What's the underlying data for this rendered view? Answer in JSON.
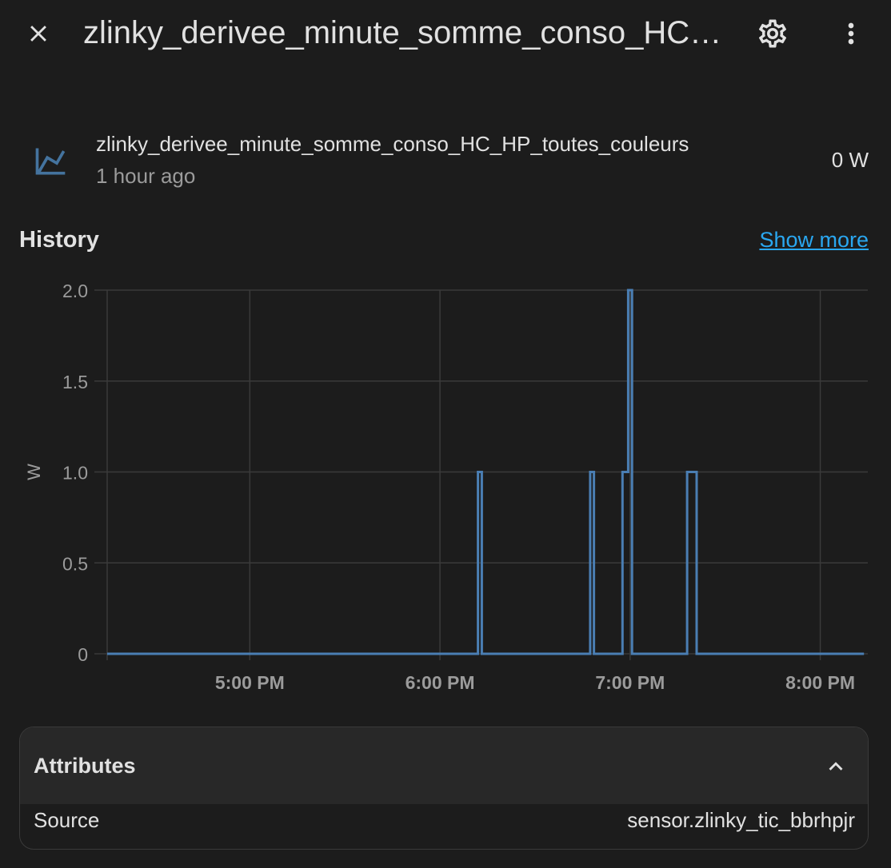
{
  "header": {
    "title": "zlinky_derivee_minute_somme_conso_HC_HP_toutes_couleurs",
    "close_icon": "close-icon",
    "settings_icon": "gear-icon",
    "more_icon": "dots-vertical-icon"
  },
  "entity": {
    "name": "zlinky_derivee_minute_somme_conso_HC_HP_toutes_couleurs",
    "last_changed": "1 hour ago",
    "state": "0 W",
    "icon": "chart-line-icon",
    "icon_color": "#44739e"
  },
  "history": {
    "title": "History",
    "show_more": "Show more"
  },
  "chart_data": {
    "type": "line",
    "ylabel": "W",
    "ylim": [
      0,
      2.0
    ],
    "yticks": [
      "0",
      "0.5",
      "1.0",
      "1.5",
      "2.0"
    ],
    "xlim": [
      16.25,
      20.25
    ],
    "xticks": [
      {
        "label": "5:00 PM",
        "value": 17
      },
      {
        "label": "6:00 PM",
        "value": 18
      },
      {
        "label": "7:00 PM",
        "value": 19
      },
      {
        "label": "8:00 PM",
        "value": 20
      }
    ],
    "step": true,
    "line_color": "#4a7eb3",
    "series": [
      {
        "points": [
          [
            16.25,
            0
          ],
          [
            18.2,
            0
          ],
          [
            18.2,
            1
          ],
          [
            18.22,
            1
          ],
          [
            18.22,
            0
          ],
          [
            18.79,
            0
          ],
          [
            18.79,
            1
          ],
          [
            18.81,
            1
          ],
          [
            18.81,
            0
          ],
          [
            18.96,
            0
          ],
          [
            18.96,
            1
          ],
          [
            18.99,
            1
          ],
          [
            18.99,
            2
          ],
          [
            19.01,
            2
          ],
          [
            19.01,
            0
          ],
          [
            19.3,
            0
          ],
          [
            19.3,
            1
          ],
          [
            19.35,
            1
          ],
          [
            19.35,
            0
          ],
          [
            20.23,
            0
          ]
        ]
      }
    ]
  },
  "attributes": {
    "title": "Attributes",
    "chevron_icon": "chevron-up-icon",
    "rows": [
      {
        "key": "Source",
        "value": "sensor.zlinky_tic_bbrhpjr"
      }
    ]
  }
}
